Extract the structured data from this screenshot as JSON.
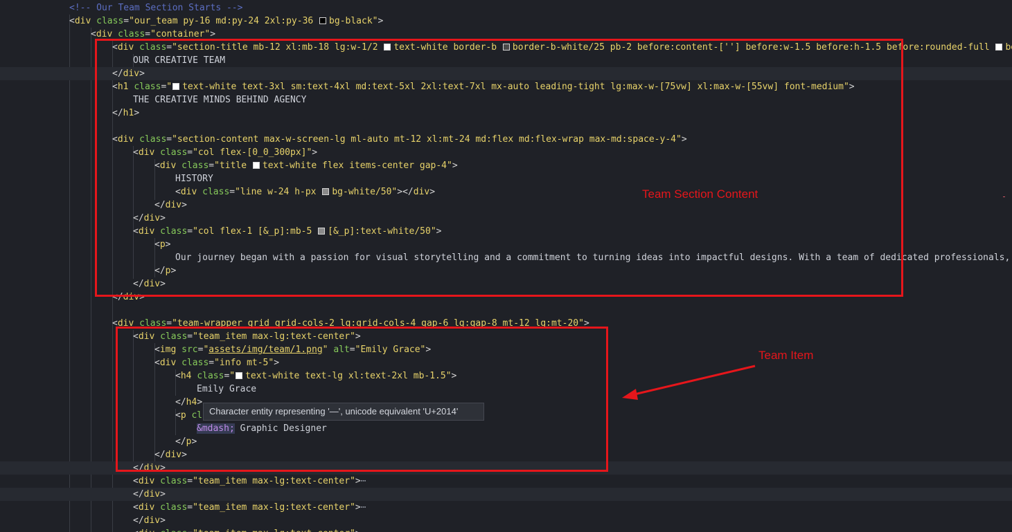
{
  "editor": {
    "background": "#1f2127",
    "lines": [
      [
        {
          "t": "cmt",
          "v": "<!-- Our Team Section Starts -->"
        }
      ],
      [
        {
          "t": "pun",
          "v": "<"
        },
        {
          "t": "tag",
          "v": "div"
        },
        {
          "t": "pun",
          "v": " "
        },
        {
          "t": "attr",
          "v": "class"
        },
        {
          "t": "pun",
          "v": "="
        },
        {
          "t": "str",
          "v": "\"our_team py-16 md:py-24 2xl:py-36 "
        },
        {
          "t": "sw",
          "c": "#000000"
        },
        {
          "t": "str",
          "v": "bg-black\""
        },
        {
          "t": "pun",
          "v": ">"
        }
      ],
      [
        {
          "t": "pun",
          "v": "<"
        },
        {
          "t": "tag",
          "v": "div"
        },
        {
          "t": "pun",
          "v": " "
        },
        {
          "t": "attr",
          "v": "class"
        },
        {
          "t": "pun",
          "v": "="
        },
        {
          "t": "str",
          "v": "\"container\""
        },
        {
          "t": "pun",
          "v": ">"
        }
      ],
      [
        {
          "t": "pun",
          "v": "<"
        },
        {
          "t": "tag",
          "v": "div"
        },
        {
          "t": "pun",
          "v": " "
        },
        {
          "t": "attr",
          "v": "class"
        },
        {
          "t": "pun",
          "v": "="
        },
        {
          "t": "str",
          "v": "\"section-title mb-12 xl:mb-18 lg:w-1/2 "
        },
        {
          "t": "sw",
          "c": "#ffffff"
        },
        {
          "t": "str",
          "v": "text-white border-b "
        },
        {
          "t": "sw",
          "c": "#4a4a4a"
        },
        {
          "t": "str",
          "v": "border-b-white/25 pb-2 before:content-[''] before:w-1.5 before:h-1.5 before:rounded-full "
        },
        {
          "t": "sw",
          "c": "#ffffff"
        },
        {
          "t": "str",
          "v": "bef"
        }
      ],
      [
        {
          "t": "text",
          "v": "OUR CREATIVE TEAM"
        }
      ],
      [
        {
          "t": "pun",
          "v": "</"
        },
        {
          "t": "tag",
          "v": "div"
        },
        {
          "t": "pun",
          "v": ">"
        }
      ],
      [
        {
          "t": "pun",
          "v": "<"
        },
        {
          "t": "tag",
          "v": "h1"
        },
        {
          "t": "pun",
          "v": " "
        },
        {
          "t": "attr",
          "v": "class"
        },
        {
          "t": "pun",
          "v": "="
        },
        {
          "t": "str",
          "v": "\""
        },
        {
          "t": "sw",
          "c": "#ffffff"
        },
        {
          "t": "str",
          "v": "text-white text-3xl sm:text-4xl md:text-5xl 2xl:text-7xl mx-auto leading-tight lg:max-w-[75vw] xl:max-w-[55vw] font-medium\""
        },
        {
          "t": "pun",
          "v": ">"
        }
      ],
      [
        {
          "t": "text",
          "v": "THE CREATIVE MINDS BEHIND AGENCY"
        }
      ],
      [
        {
          "t": "pun",
          "v": "</"
        },
        {
          "t": "tag",
          "v": "h1"
        },
        {
          "t": "pun",
          "v": ">"
        }
      ],
      [],
      [
        {
          "t": "pun",
          "v": "<"
        },
        {
          "t": "tag",
          "v": "div"
        },
        {
          "t": "pun",
          "v": " "
        },
        {
          "t": "attr",
          "v": "class"
        },
        {
          "t": "pun",
          "v": "="
        },
        {
          "t": "str",
          "v": "\"section-content max-w-screen-lg ml-auto mt-12 xl:mt-24 md:flex md:flex-wrap max-md:space-y-4\""
        },
        {
          "t": "pun",
          "v": ">"
        }
      ],
      [
        {
          "t": "pun",
          "v": "<"
        },
        {
          "t": "tag",
          "v": "div"
        },
        {
          "t": "pun",
          "v": " "
        },
        {
          "t": "attr",
          "v": "class"
        },
        {
          "t": "pun",
          "v": "="
        },
        {
          "t": "str",
          "v": "\"col flex-[0_0_300px]\""
        },
        {
          "t": "pun",
          "v": ">"
        }
      ],
      [
        {
          "t": "pun",
          "v": "<"
        },
        {
          "t": "tag",
          "v": "div"
        },
        {
          "t": "pun",
          "v": " "
        },
        {
          "t": "attr",
          "v": "class"
        },
        {
          "t": "pun",
          "v": "="
        },
        {
          "t": "str",
          "v": "\"title "
        },
        {
          "t": "sw",
          "c": "#ffffff"
        },
        {
          "t": "str",
          "v": "text-white flex items-center gap-4\""
        },
        {
          "t": "pun",
          "v": ">"
        }
      ],
      [
        {
          "t": "text",
          "v": "HISTORY"
        }
      ],
      [
        {
          "t": "pun",
          "v": "<"
        },
        {
          "t": "tag",
          "v": "div"
        },
        {
          "t": "pun",
          "v": " "
        },
        {
          "t": "attr",
          "v": "class"
        },
        {
          "t": "pun",
          "v": "="
        },
        {
          "t": "str",
          "v": "\"line w-24 h-px "
        },
        {
          "t": "sw",
          "c": "#8a8a8a"
        },
        {
          "t": "str",
          "v": "bg-white/50\""
        },
        {
          "t": "pun",
          "v": "></"
        },
        {
          "t": "tag",
          "v": "div"
        },
        {
          "t": "pun",
          "v": ">"
        }
      ],
      [
        {
          "t": "pun",
          "v": "</"
        },
        {
          "t": "tag",
          "v": "div"
        },
        {
          "t": "pun",
          "v": ">"
        }
      ],
      [
        {
          "t": "pun",
          "v": "</"
        },
        {
          "t": "tag",
          "v": "div"
        },
        {
          "t": "pun",
          "v": ">"
        }
      ],
      [
        {
          "t": "pun",
          "v": "<"
        },
        {
          "t": "tag",
          "v": "div"
        },
        {
          "t": "pun",
          "v": " "
        },
        {
          "t": "attr",
          "v": "class"
        },
        {
          "t": "pun",
          "v": "="
        },
        {
          "t": "str",
          "v": "\"col flex-1 [&_p]:mb-5 "
        },
        {
          "t": "sw",
          "c": "#8a8a8a"
        },
        {
          "t": "str",
          "v": "[&_p]:text-white/50\""
        },
        {
          "t": "pun",
          "v": ">"
        }
      ],
      [
        {
          "t": "pun",
          "v": "<"
        },
        {
          "t": "tag",
          "v": "p"
        },
        {
          "t": "pun",
          "v": ">"
        }
      ],
      [
        {
          "t": "text",
          "v": "Our journey began with a passion for visual storytelling and a commitment to turning ideas into impactful designs. With a team of dedicated professionals,"
        }
      ],
      [
        {
          "t": "pun",
          "v": "</"
        },
        {
          "t": "tag",
          "v": "p"
        },
        {
          "t": "pun",
          "v": ">"
        }
      ],
      [
        {
          "t": "pun",
          "v": "</"
        },
        {
          "t": "tag",
          "v": "div"
        },
        {
          "t": "pun",
          "v": ">"
        }
      ],
      [
        {
          "t": "pun",
          "v": "</"
        },
        {
          "t": "tag",
          "v": "div"
        },
        {
          "t": "pun",
          "v": ">"
        }
      ],
      [],
      [
        {
          "t": "pun",
          "v": "<"
        },
        {
          "t": "tag",
          "v": "div"
        },
        {
          "t": "pun",
          "v": " "
        },
        {
          "t": "attr",
          "v": "class"
        },
        {
          "t": "pun",
          "v": "="
        },
        {
          "t": "str",
          "v": "\"team-wrapper grid grid-cols-2 lg:grid-cols-4 gap-6 lg:gap-8 mt-12 lg:mt-20\""
        },
        {
          "t": "pun",
          "v": ">"
        }
      ],
      [
        {
          "t": "pun",
          "v": "<"
        },
        {
          "t": "tag",
          "v": "div"
        },
        {
          "t": "pun",
          "v": " "
        },
        {
          "t": "attr",
          "v": "class"
        },
        {
          "t": "pun",
          "v": "="
        },
        {
          "t": "str",
          "v": "\"team_item max-lg:text-center\""
        },
        {
          "t": "pun",
          "v": ">"
        }
      ],
      [
        {
          "t": "pun",
          "v": "<"
        },
        {
          "t": "tag",
          "v": "img"
        },
        {
          "t": "pun",
          "v": " "
        },
        {
          "t": "attr",
          "v": "src"
        },
        {
          "t": "pun",
          "v": "="
        },
        {
          "t": "str",
          "v": "\""
        },
        {
          "t": "link",
          "v": "assets/img/team/1.png"
        },
        {
          "t": "str",
          "v": "\""
        },
        {
          "t": "pun",
          "v": " "
        },
        {
          "t": "attr",
          "v": "alt"
        },
        {
          "t": "pun",
          "v": "="
        },
        {
          "t": "str",
          "v": "\"Emily Grace\""
        },
        {
          "t": "pun",
          "v": ">"
        }
      ],
      [
        {
          "t": "pun",
          "v": "<"
        },
        {
          "t": "tag",
          "v": "div"
        },
        {
          "t": "pun",
          "v": " "
        },
        {
          "t": "attr",
          "v": "class"
        },
        {
          "t": "pun",
          "v": "="
        },
        {
          "t": "str",
          "v": "\"info mt-5\""
        },
        {
          "t": "pun",
          "v": ">"
        }
      ],
      [
        {
          "t": "pun",
          "v": "<"
        },
        {
          "t": "tag",
          "v": "h4"
        },
        {
          "t": "pun",
          "v": " "
        },
        {
          "t": "attr",
          "v": "class"
        },
        {
          "t": "pun",
          "v": "="
        },
        {
          "t": "str",
          "v": "\""
        },
        {
          "t": "sw",
          "c": "#ffffff"
        },
        {
          "t": "str",
          "v": "text-white text-lg xl:text-2xl mb-1.5\""
        },
        {
          "t": "pun",
          "v": ">"
        }
      ],
      [
        {
          "t": "text",
          "v": "Emily Grace"
        }
      ],
      [
        {
          "t": "pun",
          "v": "</"
        },
        {
          "t": "tag",
          "v": "h4"
        },
        {
          "t": "pun",
          "v": ">"
        }
      ],
      [
        {
          "t": "pun",
          "v": "<"
        },
        {
          "t": "tag",
          "v": "p"
        },
        {
          "t": "pun",
          "v": " "
        },
        {
          "t": "attr",
          "v": "cl"
        }
      ],
      [
        {
          "t": "ent",
          "v": "&mdash;"
        },
        {
          "t": "text",
          "v": " Graphic Designer"
        }
      ],
      [
        {
          "t": "pun",
          "v": "</"
        },
        {
          "t": "tag",
          "v": "p"
        },
        {
          "t": "pun",
          "v": ">"
        }
      ],
      [
        {
          "t": "pun",
          "v": "</"
        },
        {
          "t": "tag",
          "v": "div"
        },
        {
          "t": "pun",
          "v": ">"
        }
      ],
      [
        {
          "t": "pun",
          "v": "</"
        },
        {
          "t": "tag",
          "v": "div"
        },
        {
          "t": "pun",
          "v": ">"
        }
      ],
      [
        {
          "t": "pun",
          "v": "<"
        },
        {
          "t": "tag",
          "v": "div"
        },
        {
          "t": "pun",
          "v": " "
        },
        {
          "t": "attr",
          "v": "class"
        },
        {
          "t": "pun",
          "v": "="
        },
        {
          "t": "str",
          "v": "\"team_item max-lg:text-center\""
        },
        {
          "t": "pun",
          "v": ">"
        },
        {
          "t": "ell",
          "v": "⋯"
        }
      ],
      [
        {
          "t": "pun",
          "v": "</"
        },
        {
          "t": "tag",
          "v": "div"
        },
        {
          "t": "pun",
          "v": ">"
        }
      ],
      [
        {
          "t": "pun",
          "v": "<"
        },
        {
          "t": "tag",
          "v": "div"
        },
        {
          "t": "pun",
          "v": " "
        },
        {
          "t": "attr",
          "v": "class"
        },
        {
          "t": "pun",
          "v": "="
        },
        {
          "t": "str",
          "v": "\"team_item max-lg:text-center\""
        },
        {
          "t": "pun",
          "v": ">"
        },
        {
          "t": "ell",
          "v": "⋯"
        }
      ],
      [
        {
          "t": "pun",
          "v": "</"
        },
        {
          "t": "tag",
          "v": "div"
        },
        {
          "t": "pun",
          "v": ">"
        }
      ],
      [
        {
          "t": "pun",
          "v": "<"
        },
        {
          "t": "tag",
          "v": "div"
        },
        {
          "t": "pun",
          "v": " "
        },
        {
          "t": "attr",
          "v": "class"
        },
        {
          "t": "pun",
          "v": "="
        },
        {
          "t": "str",
          "v": "\"team_item max-lg:text-center\""
        },
        {
          "t": "pun",
          "v": ">"
        }
      ]
    ]
  },
  "annotations": {
    "color": "#e5161b",
    "section_label": "Team Section Content",
    "item_label": "Team Item"
  },
  "tooltip": {
    "text": "Character entity representing '—', unicode equivalent 'U+2014'"
  }
}
